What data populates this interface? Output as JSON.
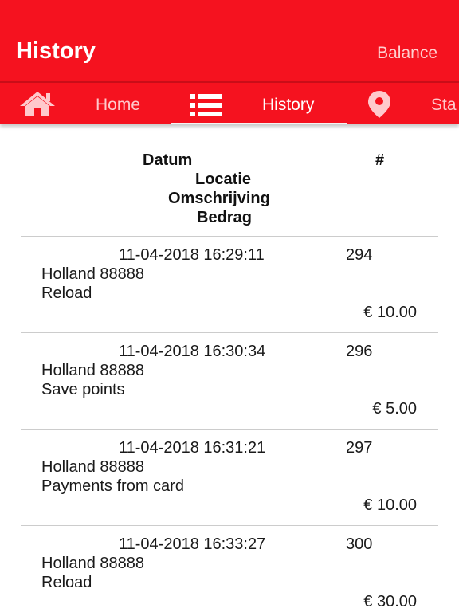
{
  "appbar": {
    "title": "History",
    "action": "Balance"
  },
  "tabs": [
    {
      "icon": "home-icon",
      "label": "Home",
      "active": false
    },
    {
      "icon": "list-icon",
      "label": "History",
      "active": true
    },
    {
      "icon": "location-pin-icon",
      "label": "Sta",
      "active": false
    }
  ],
  "table": {
    "headers": {
      "date": "Datum",
      "location": "Locatie",
      "description": "Omschrijving",
      "amount": "Bedrag",
      "number": "#"
    },
    "rows": [
      {
        "datetime": "11-04-2018 16:29:11",
        "number": "294",
        "location": "Holland 88888",
        "description": "Reload",
        "amount": "€ 10.00"
      },
      {
        "datetime": "11-04-2018 16:30:34",
        "number": "296",
        "location": "Holland 88888",
        "description": "Save points",
        "amount": "€ 5.00"
      },
      {
        "datetime": "11-04-2018 16:31:21",
        "number": "297",
        "location": "Holland 88888",
        "description": "Payments from card",
        "amount": "€ 10.00"
      },
      {
        "datetime": "11-04-2018 16:33:27",
        "number": "300",
        "location": "Holland 88888",
        "description": "Reload",
        "amount": "€ 30.00"
      }
    ]
  },
  "colors": {
    "brand": "#f5121f",
    "tab_inactive_text": "#ffc9cc",
    "divider": "#cccccc"
  }
}
